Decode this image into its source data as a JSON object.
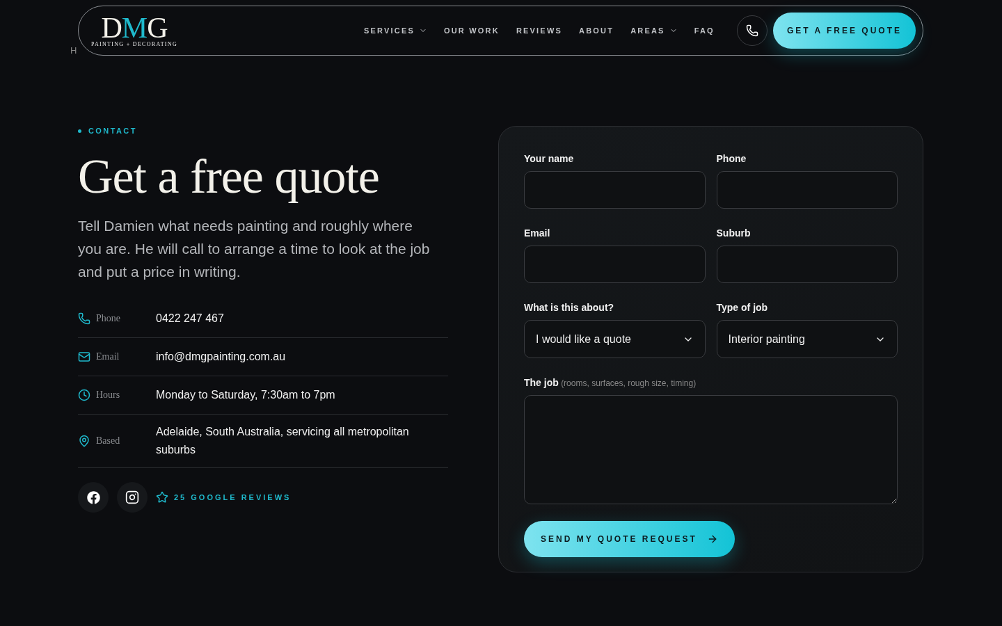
{
  "header": {
    "logo": {
      "letters": [
        {
          "text": "D",
          "accent": false
        },
        {
          "text": "M",
          "accent": true
        },
        {
          "text": "G",
          "accent": false
        }
      ],
      "tagline": "PAINTING + DECORATING"
    },
    "breadcrumb": "H",
    "nav": [
      {
        "label": "SERVICES",
        "dropdown": true
      },
      {
        "label": "OUR WORK",
        "dropdown": false
      },
      {
        "label": "REVIEWS",
        "dropdown": false
      },
      {
        "label": "ABOUT",
        "dropdown": false
      },
      {
        "label": "AREAS",
        "dropdown": true
      },
      {
        "label": "FAQ",
        "dropdown": false
      }
    ],
    "cta": "GET A FREE QUOTE"
  },
  "intro": {
    "eyebrow": "CONTACT",
    "title": "Get a free quote",
    "lead": "Tell Damien what needs painting and roughly where you are. He will call to arrange a time to look at the job and put a price in writing."
  },
  "details": [
    {
      "kind": "phone",
      "label": "Phone",
      "value": "0422 247 467"
    },
    {
      "kind": "email",
      "label": "Email",
      "value": "info@dmgpainting.com.au"
    },
    {
      "kind": "hours",
      "label": "Hours",
      "value": "Monday to Saturday, 7:30am to 7pm"
    },
    {
      "kind": "location",
      "label": "Based",
      "value": "Adelaide, South Australia, servicing all metropolitan suburbs"
    }
  ],
  "socials": [
    {
      "kind": "facebook"
    },
    {
      "kind": "instagram"
    }
  ],
  "reviews_link": "25 GOOGLE REVIEWS",
  "form": {
    "fields": [
      {
        "kind": "input",
        "label": "Your name"
      },
      {
        "kind": "input",
        "label": "Phone"
      },
      {
        "kind": "input",
        "label": "Email"
      },
      {
        "kind": "input",
        "label": "Suburb"
      },
      {
        "kind": "select",
        "label": "What is this about?",
        "value": "I would like a quote"
      },
      {
        "kind": "select",
        "label": "Type of job",
        "value": "Interior painting"
      },
      {
        "kind": "textarea",
        "label": "The job",
        "hint": "(rooms, surfaces, rough size, timing)"
      }
    ],
    "submit": "SEND MY QUOTE REQUEST"
  }
}
